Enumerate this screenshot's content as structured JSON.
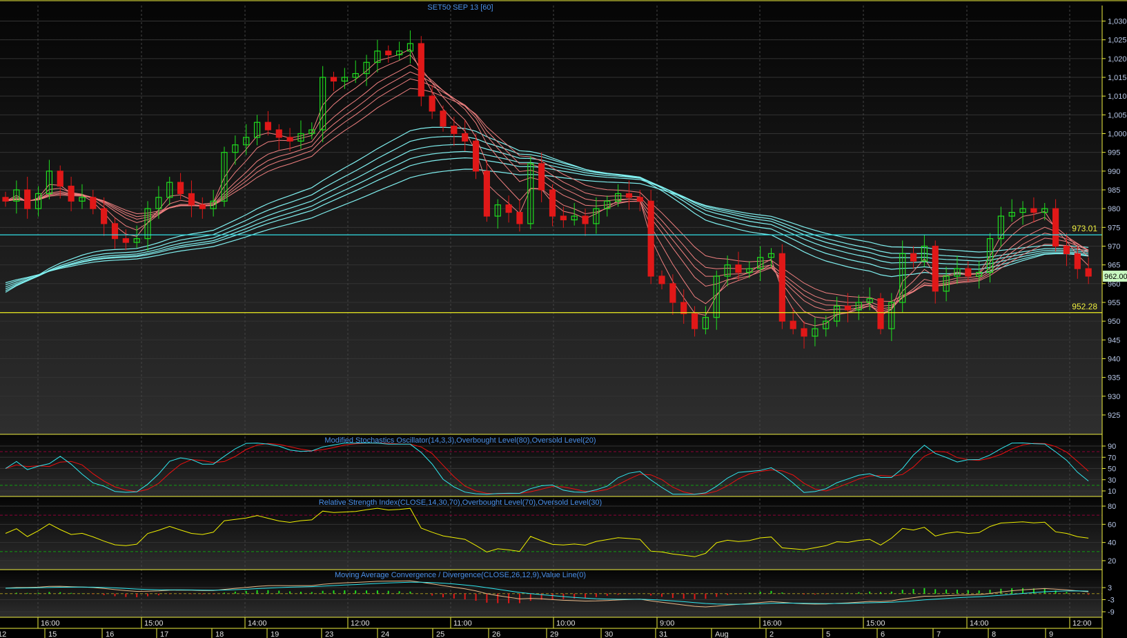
{
  "title": "SET50 SEP 13  [60]",
  "chart_data": {
    "type": "candlestick",
    "title": "SET50 SEP 13  [60]",
    "close": [
      982,
      985,
      980,
      984,
      990,
      986,
      982,
      983,
      980,
      976,
      972,
      971,
      972,
      980,
      983,
      987,
      984,
      981,
      980,
      982,
      995,
      997,
      999,
      1003,
      1001,
      999,
      998,
      1000,
      1001,
      1015,
      1014,
      1015,
      1016,
      1019,
      1022,
      1021,
      1022,
      1024,
      1010,
      1006,
      1002,
      1000,
      998,
      990,
      978,
      981,
      979,
      976,
      992,
      985,
      978,
      977,
      978,
      976,
      980,
      982,
      984,
      983,
      982,
      962,
      960,
      955,
      952,
      948,
      951,
      962,
      965,
      963,
      964,
      967,
      968,
      950,
      948,
      946,
      948,
      950,
      954,
      953,
      955,
      956,
      948,
      955,
      968,
      966,
      970,
      958,
      962,
      964,
      962,
      963,
      972,
      978,
      979,
      980,
      979,
      980,
      970,
      968,
      964,
      962
    ],
    "ylim": [
      921,
      1035
    ],
    "y_ticks": [
      "1,030",
      "1,025",
      "1,020",
      "1,015",
      "1,010",
      "1,005",
      "1,000",
      "995",
      "990",
      "985",
      "980",
      "975",
      "970",
      "965",
      "960",
      "955",
      "950",
      "945",
      "940",
      "935",
      "930",
      "925"
    ],
    "y_tick_values": [
      1030,
      1025,
      1020,
      1015,
      1010,
      1005,
      1000,
      995,
      990,
      985,
      980,
      975,
      970,
      965,
      960,
      955,
      950,
      945,
      940,
      935,
      930,
      925
    ],
    "last_price": "962.00",
    "horizontal_lines": [
      {
        "value": 973.01,
        "label": "973.01",
        "color": "#33e0e8"
      },
      {
        "value": 952.28,
        "label": "952.28",
        "color": "#f0f020"
      }
    ],
    "short_ema_color": "#f08080",
    "long_ema_color": "#80f0f0",
    "up_color": "#20e020",
    "down_color": "#e01818",
    "grid": true,
    "hour_labels": [
      "16:00",
      "15:00",
      "14:00",
      "12:00",
      "11:00",
      "10:00",
      "9:00",
      "16:00",
      "15:00",
      "14:00",
      "12:00"
    ],
    "date_labels": [
      "12",
      "15",
      "16",
      "17",
      "18",
      "19",
      "23",
      "24",
      "25",
      "26",
      "29",
      "30",
      "31",
      "Aug",
      "2",
      "5",
      "6",
      "7",
      "8",
      "9"
    ],
    "indicators": {
      "stochastic": {
        "title": "Modified Stochastics Oscillator(14,3,3),Overbought Level(80),Oversold Level(20)",
        "ticks": [
          "90",
          "70",
          "50",
          "30",
          "10"
        ],
        "tick_values": [
          90,
          70,
          50,
          30,
          10
        ],
        "overbought": 80,
        "oversold": 20,
        "k_color": "#30e8f0",
        "d_color": "#f01010"
      },
      "rsi": {
        "title": "Relative Strength Index(CLOSE,14,30,70),Overbought Level(70),Oversold Level(30)",
        "ticks": [
          "80",
          "60",
          "40",
          "20"
        ],
        "tick_values": [
          80,
          60,
          40,
          20
        ],
        "overbought": 70,
        "oversold": 30,
        "color": "#f0f000"
      },
      "macd": {
        "title": "Moving Average Convergence / Divergence(CLOSE,26,12,9),Value Line(0)",
        "ticks": [
          "3",
          "-3",
          "-9"
        ],
        "tick_values": [
          3,
          -3,
          -9
        ],
        "macd_color": "#e8b888",
        "signal_color": "#30e8f0"
      }
    }
  }
}
